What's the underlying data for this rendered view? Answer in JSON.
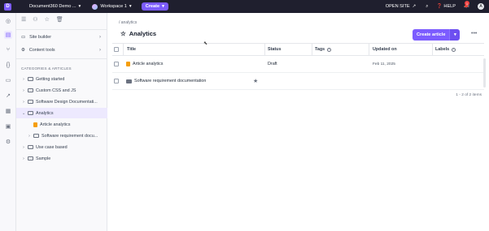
{
  "topbar": {
    "logo": "D",
    "project": "Document360 Demo ...",
    "workspace": "Workspace 1",
    "create": "Create",
    "open_site": "OPEN SITE",
    "help": "HELP",
    "notifications": "1",
    "avatar": "A",
    "accent": "#7c5cff"
  },
  "rail": {
    "icons": [
      "dashboard-icon",
      "documents-icon",
      "workflow-icon",
      "api-icon",
      "feedback-icon",
      "analytics-icon",
      "widgets-icon",
      "drive-icon",
      "settings-icon"
    ]
  },
  "sidebar": {
    "site_builder": "Site builder",
    "content_tools": "Content tools",
    "categories_label": "CATEGORIES & ARTICLES",
    "tree": [
      {
        "label": "Getting started",
        "type": "folder",
        "expanded": false
      },
      {
        "label": "Custom CSS and JS",
        "type": "folder",
        "expanded": false
      },
      {
        "label": "Software Design Documentati...",
        "type": "folder",
        "expanded": false
      },
      {
        "label": "Analytics",
        "type": "folder",
        "expanded": true,
        "selected": true
      },
      {
        "label": "Article analytics",
        "type": "article"
      },
      {
        "label": "Software requirement docu...",
        "type": "folder",
        "expanded": false
      },
      {
        "label": "Use case based",
        "type": "folder",
        "expanded": false
      },
      {
        "label": "Sample",
        "type": "folder",
        "expanded": false
      }
    ]
  },
  "main": {
    "breadcrumb": "/ analytics",
    "title": "Analytics",
    "create_article": "Create article",
    "columns": {
      "title": "Title",
      "status": "Status",
      "tags": "Tags",
      "updated": "Updated on",
      "labels": "Labels"
    },
    "rows": [
      {
        "title": "Article analytics",
        "type": "article",
        "status": "Draft",
        "updated": "Feb 11, 2025"
      },
      {
        "title": "Software requirement documentation",
        "type": "folder",
        "status": "",
        "updated": ""
      }
    ],
    "pager": "1 - 2 of 2 items"
  }
}
